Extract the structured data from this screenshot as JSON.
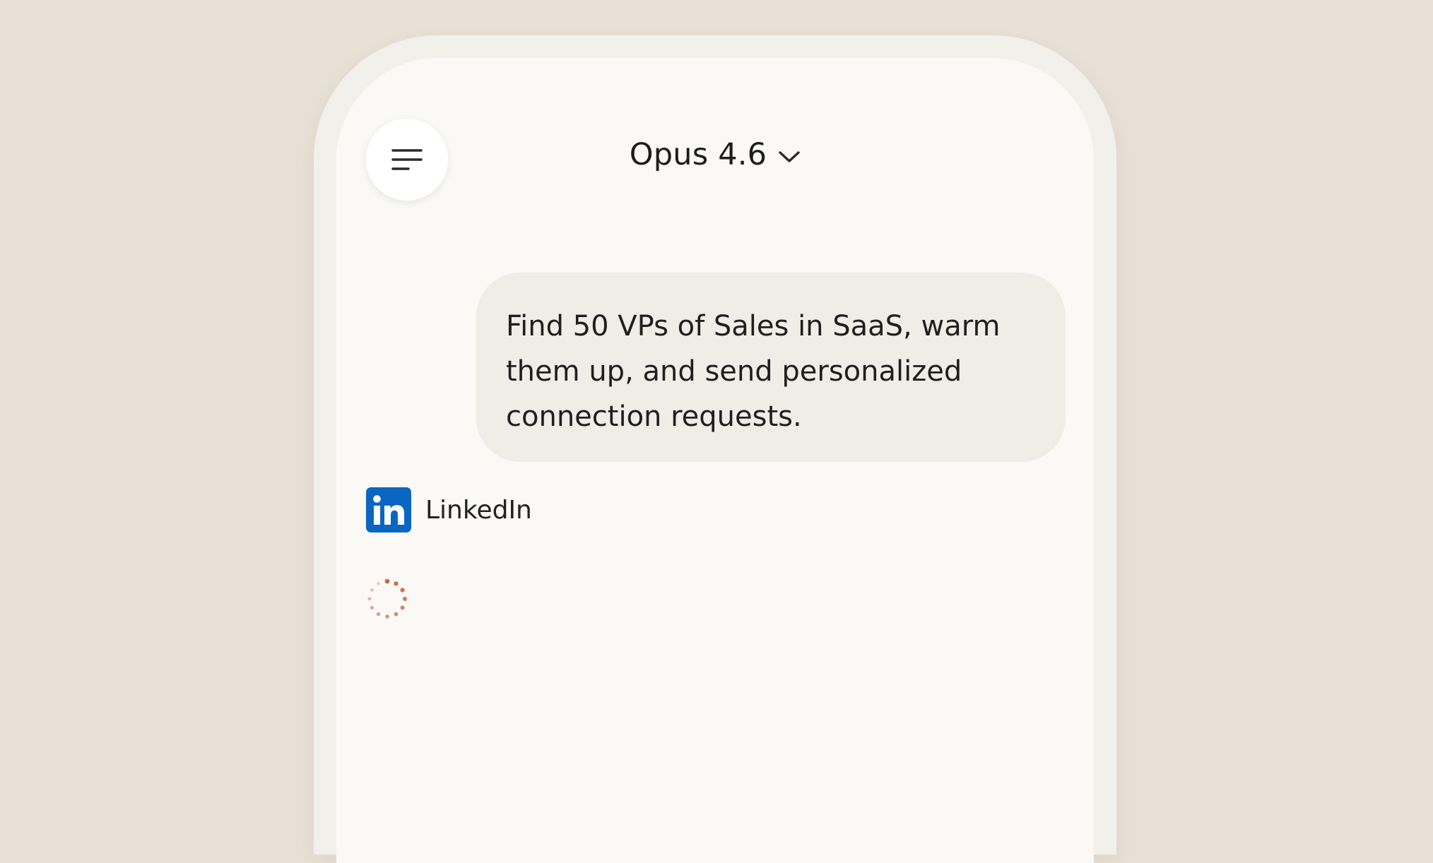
{
  "header": {
    "menu_icon": "menu-icon",
    "model_name": "Opus 4.6",
    "model_dropdown_icon": "chevron-down-icon"
  },
  "conversation": {
    "user_message": "Find 50 VPs of Sales in SaaS, warm them up, and send personalized connection requests.",
    "tool": {
      "icon": "linkedin-logo",
      "name": "LinkedIn"
    },
    "status_icon": "loading-spinner-icon"
  },
  "colors": {
    "background": "#e9e1d6",
    "screen": "#faf9f6",
    "bubble": "#f0ede7",
    "linkedin_blue": "#0a66c2",
    "spinner_accent": "#c9664a"
  }
}
